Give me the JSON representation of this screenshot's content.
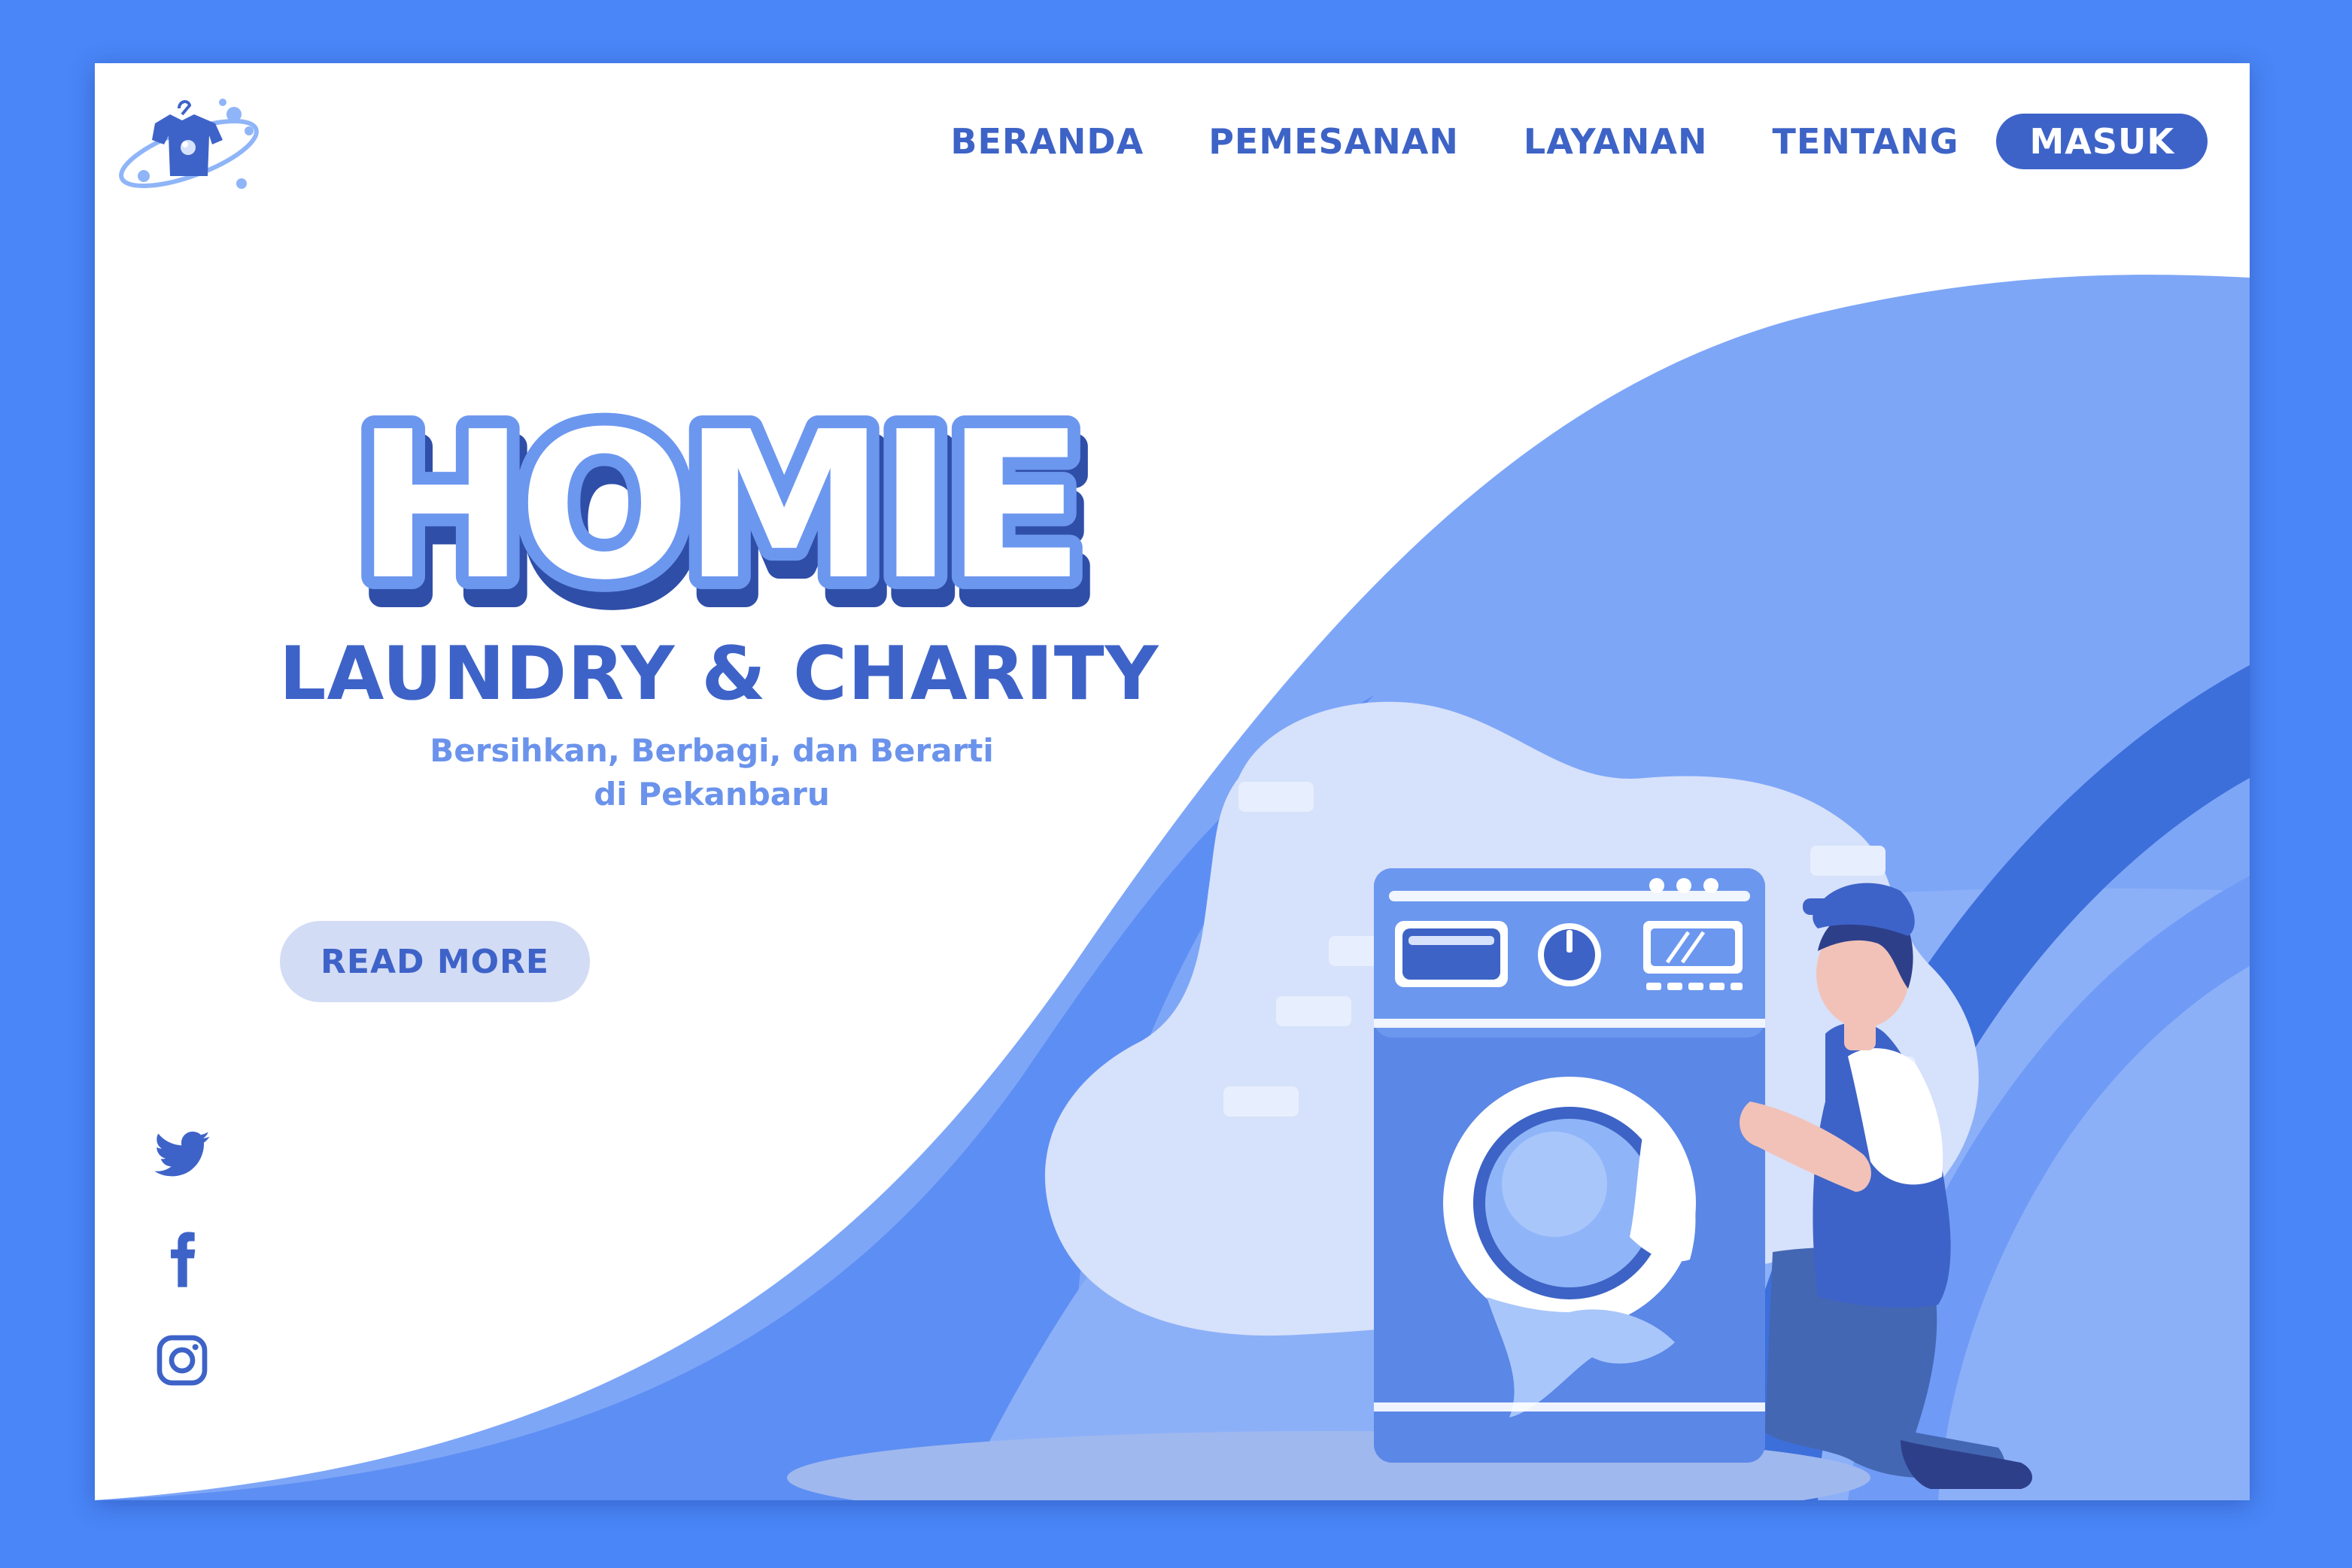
{
  "brand": {
    "name": "HOMIE",
    "subtitle": "LAUNDRY & CHARITY",
    "tagline": [
      "Bersihkan, Berbagi, dan Berarti",
      "di Pekanbaru"
    ]
  },
  "nav": {
    "items": [
      "BERANDA",
      "PEMESANAN",
      "LAYANAN",
      "TENTANG"
    ],
    "login_label": "MASUK"
  },
  "hero": {
    "cta_label": "READ MORE"
  },
  "social": [
    "twitter-icon",
    "facebook-icon",
    "instagram-icon"
  ],
  "colors": {
    "background": "#4a86f7",
    "primary": "#3e63c8",
    "light": "#d3dcf5",
    "accent": "#6b93ec"
  }
}
